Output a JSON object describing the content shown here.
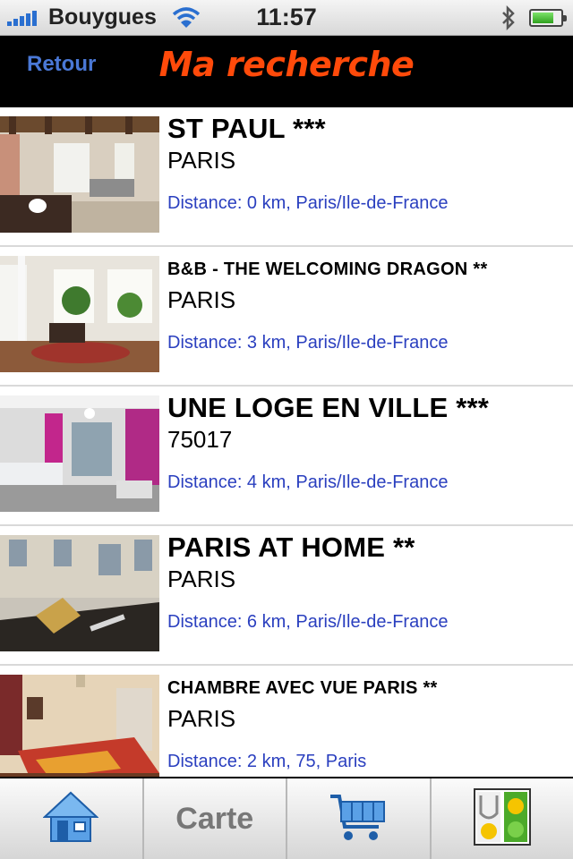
{
  "status_bar": {
    "carrier": "Bouygues",
    "time": "11:57",
    "battery_level": 0.75
  },
  "nav": {
    "back_label": "Retour",
    "title": "Ma recherche",
    "title_color": "#ff4a0a"
  },
  "results": [
    {
      "name": "ST PAUL ***",
      "city": "PARIS",
      "distance": "Distance: 0 km, Paris/Ile-de-France"
    },
    {
      "name": "B&B - THE WELCOMING DRAGON **",
      "city": "PARIS",
      "distance": "Distance: 3 km, Paris/Ile-de-France"
    },
    {
      "name": "UNE LOGE EN VILLE ***",
      "city": "75017",
      "distance": "Distance: 4 km, Paris/Ile-de-France"
    },
    {
      "name": "PARIS AT HOME **",
      "city": "PARIS",
      "distance": "Distance: 6 km, Paris/Ile-de-France"
    },
    {
      "name": "CHAMBRE AVEC VUE PARIS **",
      "city": "PARIS",
      "distance": "Distance: 2 km, 75, Paris"
    }
  ],
  "tab_bar": {
    "tabs": [
      {
        "icon": "home-icon"
      },
      {
        "label": "Carte"
      },
      {
        "icon": "cart-icon"
      },
      {
        "icon": "app-logo-icon"
      }
    ]
  }
}
